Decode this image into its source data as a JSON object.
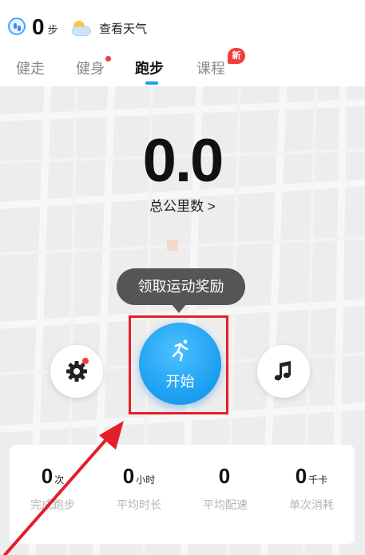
{
  "header": {
    "steps_value": "0",
    "steps_unit": "步",
    "weather_label": "查看天气",
    "step_icon": "step-counter-icon",
    "weather_icon": "partly-cloudy-icon"
  },
  "tabs": [
    {
      "label": "健走"
    },
    {
      "label": "健身"
    },
    {
      "label": "跑步",
      "active": true
    },
    {
      "label": "课程"
    }
  ],
  "badges": {
    "course_new": "新"
  },
  "main": {
    "distance_value": "0.0",
    "distance_label": "总公里数 >",
    "tooltip_text": "领取运动奖励",
    "start_label": "开始",
    "start_icon": "runner-icon",
    "settings_icon": "gear-icon",
    "music_icon": "music-note-icon"
  },
  "stats": [
    {
      "value": "0",
      "unit": "次",
      "label": "完成跑步"
    },
    {
      "value": "0",
      "unit": "小时",
      "label": "平均时长"
    },
    {
      "value": "0",
      "unit": "",
      "label": "平均配速"
    },
    {
      "value": "0",
      "unit": "千卡",
      "label": "单次消耗"
    }
  ],
  "colors": {
    "accent_blue": "#1a9df0",
    "badge_red": "#f23d3d",
    "annotation_red": "#e3202a",
    "map_background": "#ededed"
  }
}
